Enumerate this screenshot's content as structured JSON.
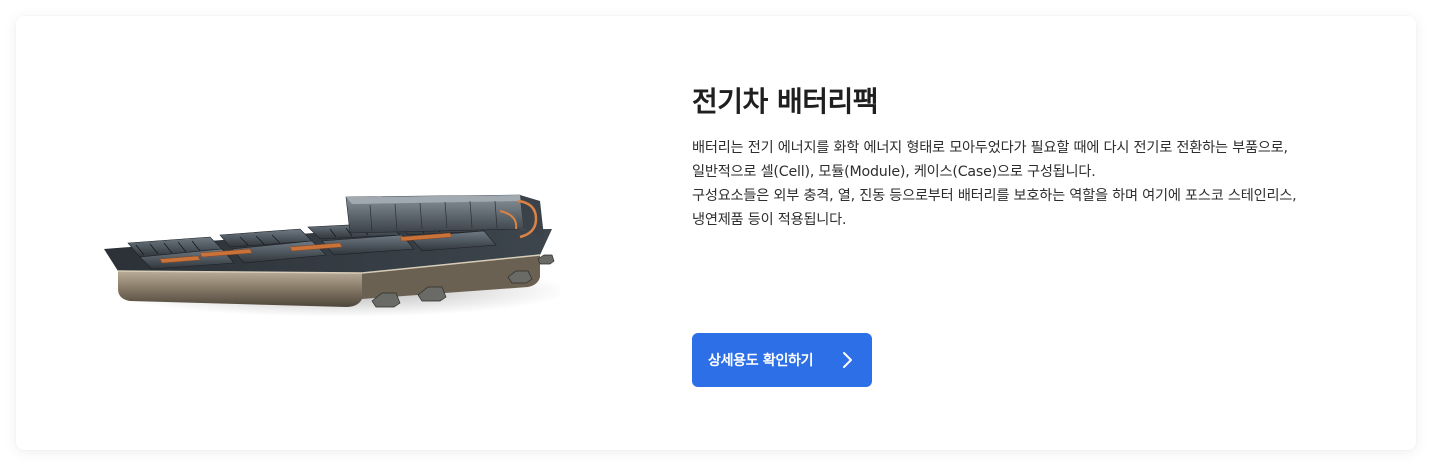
{
  "section": {
    "title": "전기차 배터리팩",
    "description_lines": [
      "배터리는 전기 에너지를 화학 에너지 형태로 모아두었다가 필요할 때에 다시 전기로 전환하는 부품으로,",
      "일반적으로 셀(Cell), 모듈(Module), 케이스(Case)으로 구성됩니다.",
      "구성요소들은 외부 충격, 열, 진동 등으로부터 배터리를 보호하는 역할을 하며 여기에 포스코 스테인리스,",
      "냉연제품 등이 적용됩니다."
    ],
    "cta_label": "상세용도 확인하기",
    "cta_icon": "chevron-right-icon",
    "image_subject": "ev-battery-pack"
  },
  "colors": {
    "accent": "#2c6fe6",
    "title_text": "#1f1f1f",
    "body_text": "#2e2e2e",
    "card_bg": "#ffffff"
  }
}
